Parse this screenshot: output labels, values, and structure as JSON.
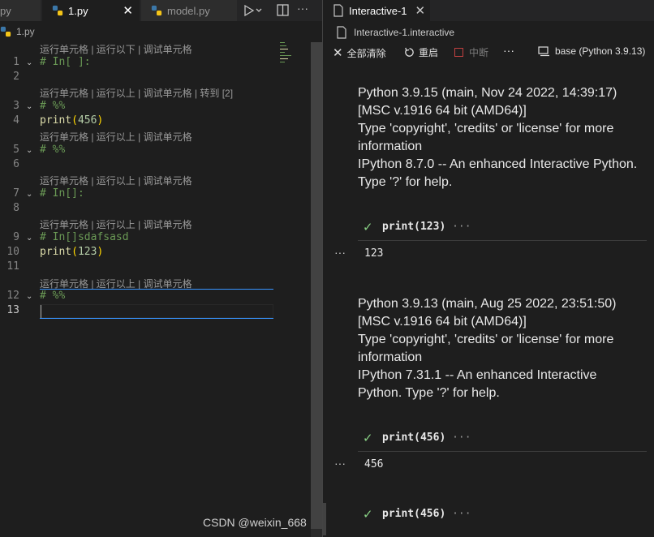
{
  "editor": {
    "tabs": [
      {
        "label": "py"
      },
      {
        "label": "1.py",
        "close": "✕"
      },
      {
        "label": "model.py"
      }
    ],
    "breadcrumb": "1.py",
    "lines": [
      {
        "n": "1",
        "text": "# In[ ]:"
      },
      {
        "n": "2",
        "text": ""
      },
      {
        "n": "3",
        "text": "# %%"
      },
      {
        "n": "4",
        "fn": "print",
        "open": "(",
        "arg": "456",
        "close": ")"
      },
      {
        "n": "5",
        "text": "# %%"
      },
      {
        "n": "6",
        "text": ""
      },
      {
        "n": "7",
        "text": "# In[]:"
      },
      {
        "n": "8",
        "text": ""
      },
      {
        "n": "9",
        "text": "# In[]sdafsasd"
      },
      {
        "n": "10",
        "fn": "print",
        "open": "(",
        "arg": "123",
        "close": ")"
      },
      {
        "n": "11",
        "text": ""
      },
      {
        "n": "12",
        "text": "# %%"
      },
      {
        "n": "13",
        "text": ""
      }
    ],
    "codelens": [
      "运行单元格 | 运行以下 | 调试单元格",
      "运行单元格 | 运行以上 | 调试单元格 | 转到 [2]",
      "运行单元格 | 运行以上 | 调试单元格",
      "运行单元格 | 运行以上 | 调试单元格",
      "运行单元格 | 运行以上 | 调试单元格",
      "运行单元格 | 运行以上 | 调试单元格"
    ]
  },
  "interactive": {
    "tab_label": "Interactive-1",
    "tab_close": "✕",
    "breadcrumb": "Interactive-1.interactive",
    "toolbar": {
      "clear_all": "全部清除",
      "restart": "重启",
      "interrupt": "中断",
      "more": "···",
      "kernel": "base (Python 3.9.13)"
    },
    "banner1": [
      "Python 3.9.15 (main, Nov 24 2022, 14:39:17)",
      "[MSC v.1916 64 bit (AMD64)]",
      "Type 'copyright', 'credits' or 'license' for more",
      "information",
      "IPython 8.7.0 -- An enhanced Interactive Python.",
      "Type '?' for help."
    ],
    "banner2": [
      "Python 3.9.13 (main, Aug 25 2022, 23:51:50)",
      "[MSC v.1916 64 bit (AMD64)]",
      "Type 'copyright', 'credits' or 'license' for more",
      "information",
      "IPython 7.31.1 -- An enhanced Interactive",
      "Python. Type '?' for help."
    ],
    "cells": [
      {
        "code": "print(123)",
        "more": "···",
        "output": "123",
        "dots": "···"
      },
      {
        "code": "print(456)",
        "more": "···",
        "output": "456",
        "dots": "···"
      },
      {
        "code": "print(456)",
        "more": "···"
      }
    ]
  },
  "watermark": "CSDN @weixin_668",
  "colors": {
    "accent": "#3794ff",
    "success": "#89d185",
    "comment": "#6a9955"
  }
}
